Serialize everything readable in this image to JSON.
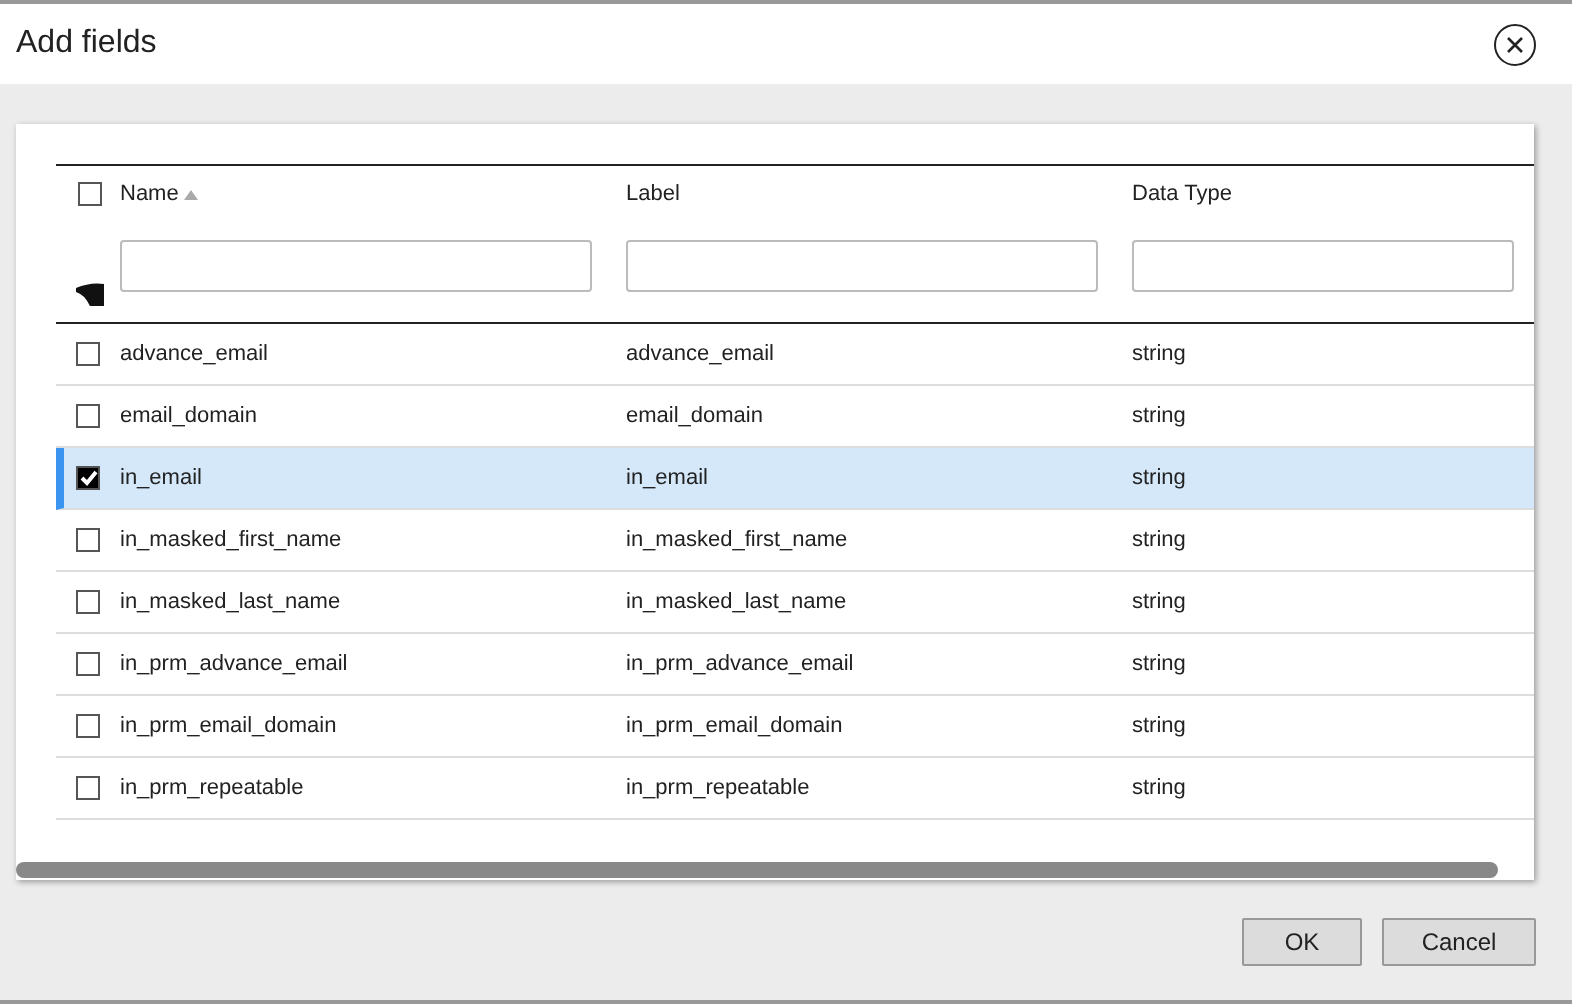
{
  "dialog": {
    "title": "Add fields"
  },
  "table": {
    "select_all": {
      "checked": false
    },
    "columns": [
      {
        "label": "Name",
        "sorted_ascending": true
      },
      {
        "label": "Label",
        "sorted_ascending": false
      },
      {
        "label": "Data Type",
        "sorted_ascending": false
      }
    ],
    "rows": [
      {
        "name": "advance_email",
        "label": "advance_email",
        "type": "string",
        "checked": false,
        "selected": false
      },
      {
        "name": "email_domain",
        "label": "email_domain",
        "type": "string",
        "checked": false,
        "selected": false
      },
      {
        "name": "in_email",
        "label": "in_email",
        "type": "string",
        "checked": true,
        "selected": true
      },
      {
        "name": "in_masked_first_name",
        "label": "in_masked_first_name",
        "type": "string",
        "checked": false,
        "selected": false
      },
      {
        "name": "in_masked_last_name",
        "label": "in_masked_last_name",
        "type": "string",
        "checked": false,
        "selected": false
      },
      {
        "name": "in_prm_advance_email",
        "label": "in_prm_advance_email",
        "type": "string",
        "checked": false,
        "selected": false
      },
      {
        "name": "in_prm_email_domain",
        "label": "in_prm_email_domain",
        "type": "string",
        "checked": false,
        "selected": false
      },
      {
        "name": "in_prm_repeatable",
        "label": "in_prm_repeatable",
        "type": "string",
        "checked": false,
        "selected": false
      }
    ]
  },
  "buttons": [
    "OK",
    "Cancel"
  ]
}
